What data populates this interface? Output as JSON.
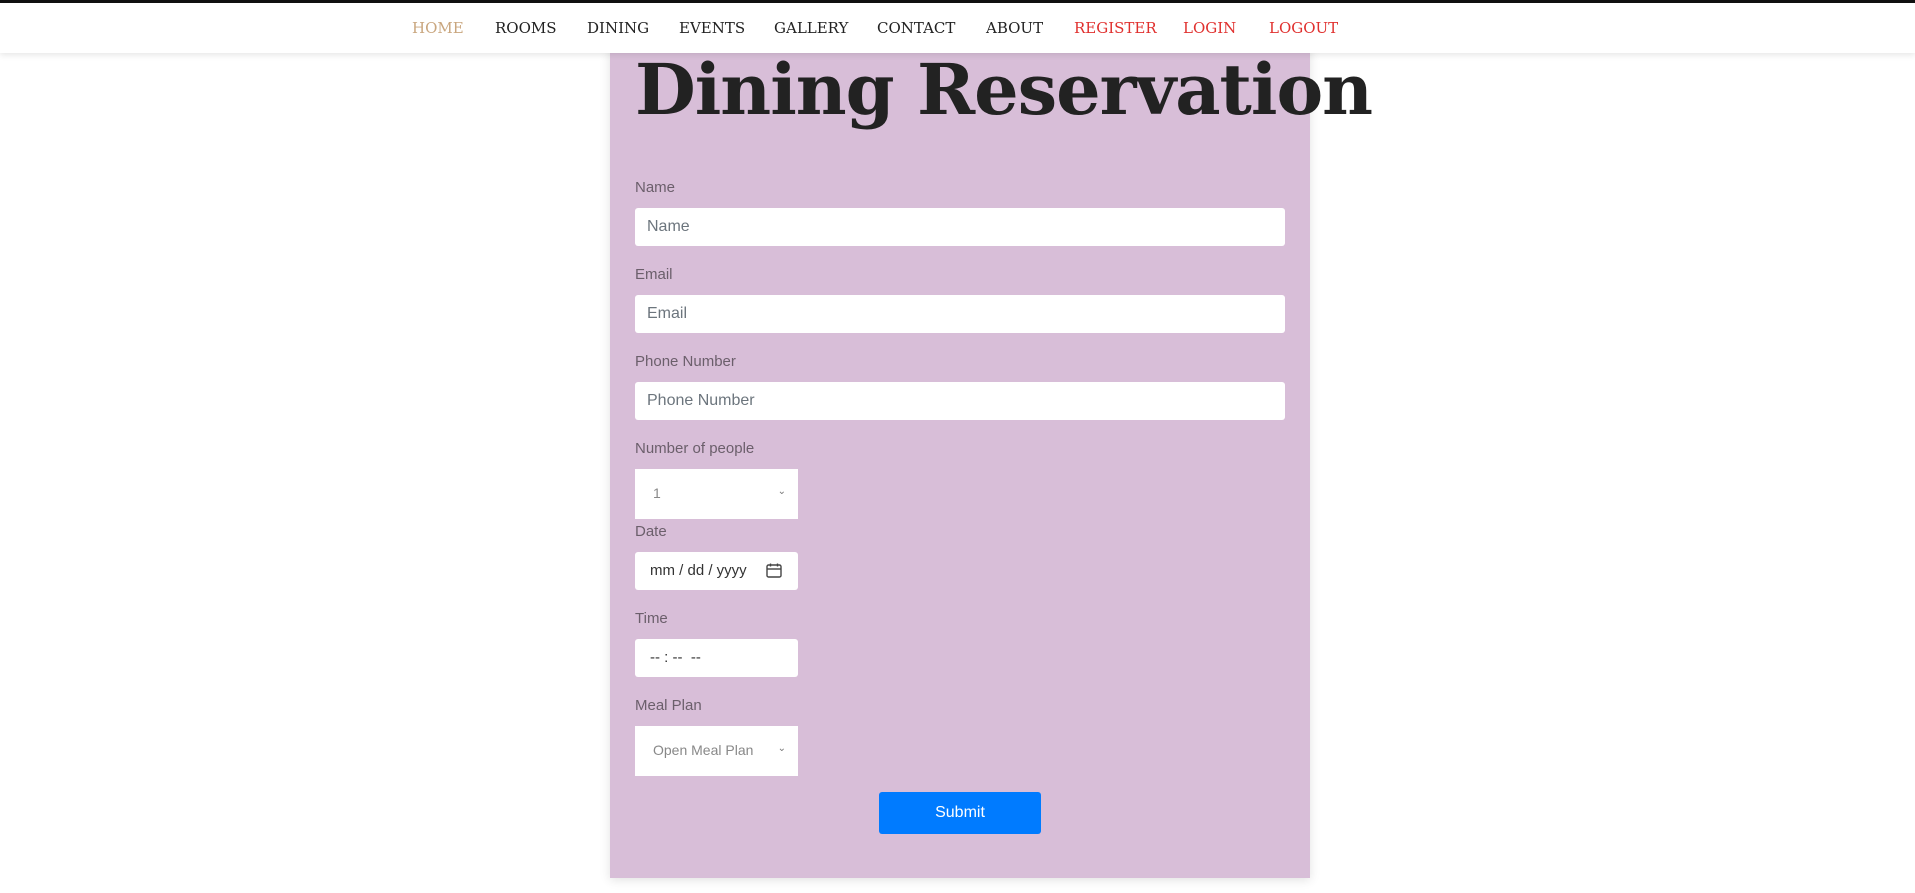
{
  "nav": {
    "items": [
      {
        "label": "HOME",
        "color": "#c9a67e"
      },
      {
        "label": "ROOMS",
        "color": "#222222"
      },
      {
        "label": "DINING",
        "color": "#222222"
      },
      {
        "label": "EVENTS",
        "color": "#222222"
      },
      {
        "label": "GALLERY",
        "color": "#222222"
      },
      {
        "label": "CONTACT",
        "color": "#222222"
      },
      {
        "label": "ABOUT",
        "color": "#222222"
      },
      {
        "label": "REGISTER",
        "color": "#e0302e"
      },
      {
        "label": "LOGIN",
        "color": "#e0302e"
      },
      {
        "label": "LOGOUT",
        "color": "#e0302e"
      }
    ]
  },
  "form": {
    "title": "Dining Reservation",
    "name_label": "Name",
    "name_placeholder": "Name",
    "email_label": "Email",
    "email_placeholder": "Email",
    "phone_label": "Phone Number",
    "phone_placeholder": "Phone Number",
    "people_label": "Number of people",
    "people_value": "1",
    "date_label": "Date",
    "date_value": "mm / dd / yyyy",
    "time_label": "Time",
    "time_value": "-- : --  --",
    "meal_label": "Meal Plan",
    "meal_value": "Open Meal Plan",
    "submit_label": "Submit"
  },
  "colors": {
    "card_bg": "#d8bed8",
    "submit_bg": "#007bff"
  }
}
